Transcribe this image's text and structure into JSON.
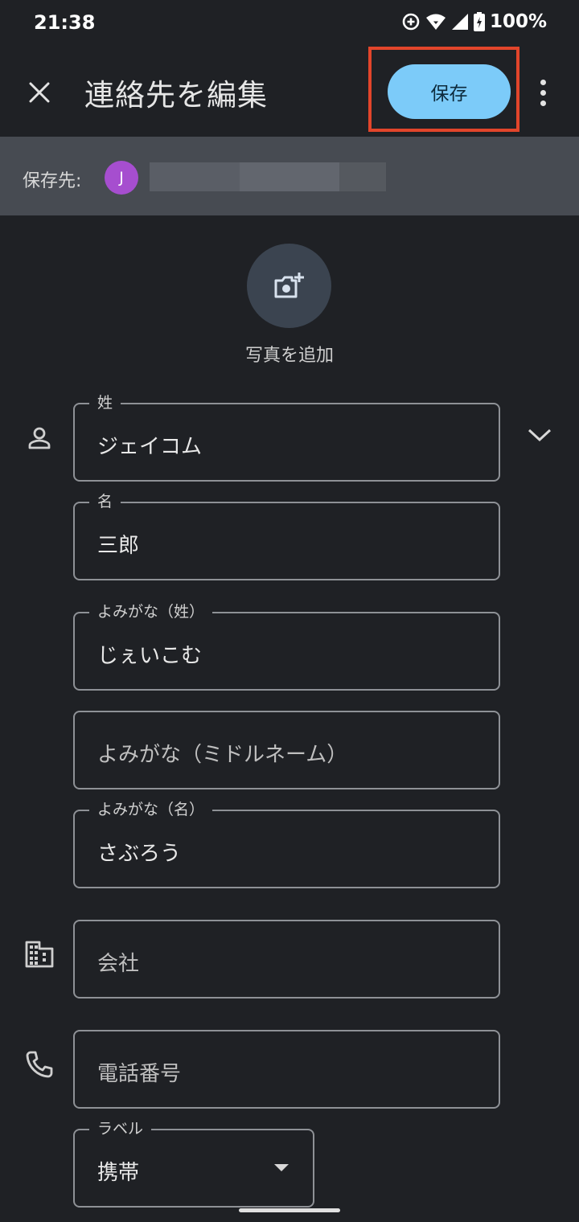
{
  "status_bar": {
    "time": "21:38",
    "battery": "100%"
  },
  "header": {
    "title": "連絡先を編集",
    "save_label": "保存"
  },
  "save_to": {
    "label": "保存先:",
    "avatar_initial": "J"
  },
  "photo": {
    "label": "写真を追加"
  },
  "fields": {
    "last_name": {
      "label": "姓",
      "value": "ジェイコム"
    },
    "first_name": {
      "label": "名",
      "value": "三郎"
    },
    "last_name_reading": {
      "label": "よみがな（姓）",
      "value": "じぇいこむ"
    },
    "middle_name_reading": {
      "placeholder": "よみがな（ミドルネーム）"
    },
    "first_name_reading": {
      "label": "よみがな（名）",
      "value": "さぶろう"
    },
    "company": {
      "placeholder": "会社"
    },
    "phone": {
      "placeholder": "電話番号"
    },
    "phone_label": {
      "label": "ラベル",
      "value": "携帯"
    }
  },
  "icons": {
    "close": "close-icon",
    "more": "more-vert-icon",
    "add_photo": "add-photo-icon",
    "person": "person-icon",
    "company": "building-icon",
    "phone": "phone-icon",
    "expand": "chevron-down-icon"
  },
  "colors": {
    "accent": "#7ccbf9",
    "highlight": "#e2452b",
    "avatar": "#a64ecf",
    "background": "#1f2125"
  }
}
